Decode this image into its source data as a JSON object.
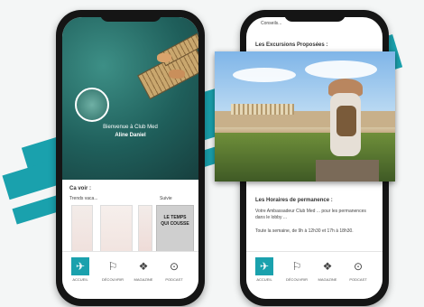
{
  "left_phone": {
    "hero_line1": "Bienvenue à Club Med",
    "hero_line2": "Aline Daniel",
    "section_title": "Ca voir :",
    "col1_title": "Trends vaca...",
    "col2_title": "Suivie",
    "book_cover_text": "LE TEMPS QUI COUSSE",
    "tabs": [
      {
        "label": "ACCUEIL",
        "icon": "home-icon"
      },
      {
        "label": "DÉCOUVRIR",
        "icon": "discover-icon"
      },
      {
        "label": "MAGAZINE",
        "icon": "magazine-icon"
      },
      {
        "label": "PODCAST",
        "icon": "podcast-icon"
      }
    ]
  },
  "right_phone": {
    "top_line": "Conseils...",
    "section1": "Les Excursions Proposées :",
    "section2": "Les Horaires de permanence :",
    "paragraph": "Votre Ambassadeur Club Med ... pour les permanences dans le lobby ...",
    "hours_line": "Toute la semaine, de 9h à 12h30 et 17h à 18h30.",
    "tabs": [
      {
        "label": "ACCUEIL",
        "icon": "home-icon"
      },
      {
        "label": "DÉCOUVRIR",
        "icon": "discover-icon"
      },
      {
        "label": "MAGAZINE",
        "icon": "magazine-icon"
      },
      {
        "label": "PODCAST",
        "icon": "podcast-icon"
      }
    ]
  }
}
